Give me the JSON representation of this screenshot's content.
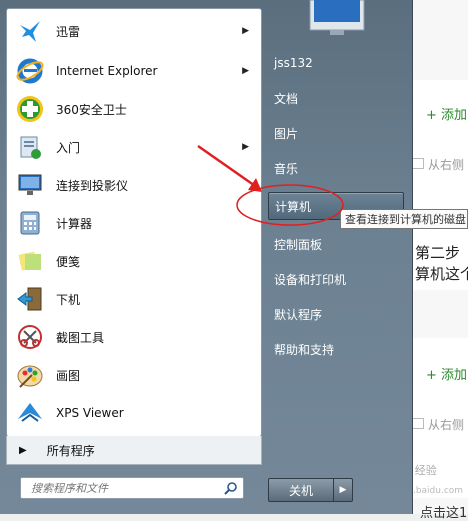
{
  "programs": [
    {
      "label": "迅雷",
      "icon": "xunlei-bird-icon",
      "arrow": true
    },
    {
      "label": "Internet Explorer",
      "icon": "internet-explorer-icon",
      "arrow": true
    },
    {
      "label": "360安全卫士",
      "icon": "360-safeguard-icon",
      "arrow": false
    },
    {
      "label": "入门",
      "icon": "getting-started-icon",
      "arrow": true
    },
    {
      "label": "连接到投影仪",
      "icon": "projector-icon",
      "arrow": false
    },
    {
      "label": "计算器",
      "icon": "calculator-icon",
      "arrow": false
    },
    {
      "label": "便笺",
      "icon": "sticky-notes-icon",
      "arrow": false
    },
    {
      "label": "下机",
      "icon": "exit-door-icon",
      "arrow": false
    },
    {
      "label": "截图工具",
      "icon": "snipping-tool-icon",
      "arrow": false
    },
    {
      "label": "画图",
      "icon": "paint-palette-icon",
      "arrow": false
    },
    {
      "label": "XPS Viewer",
      "icon": "xps-viewer-icon",
      "arrow": false
    }
  ],
  "all_programs_label": "所有程序",
  "search_placeholder": "搜索程序和文件",
  "right_items": [
    {
      "label": "jss132",
      "name": "user-folder"
    },
    {
      "label": "文档",
      "name": "documents"
    },
    {
      "label": "图片",
      "name": "pictures"
    },
    {
      "label": "音乐",
      "name": "music"
    },
    {
      "label": "计算机",
      "name": "computer"
    },
    {
      "label": "控制面板",
      "name": "control-panel"
    },
    {
      "label": "设备和打印机",
      "name": "devices-printers"
    },
    {
      "label": "默认程序",
      "name": "default-programs"
    },
    {
      "label": "帮助和支持",
      "name": "help-support"
    }
  ],
  "shutdown_label": "关机",
  "tooltip": "查看连接到计算机的磁盘",
  "background": {
    "add_label_1": "+ 添加的",
    "hint_1": "从右侧",
    "step_text_1": "第二步",
    "step_text_2": "算机这个",
    "add_label_2": "+ 添加的",
    "hint_2": "从右侧",
    "watermark": "Baidu 经验",
    "watermark_url": "jingyan.baidu.com",
    "bottom_text": "点击这1"
  },
  "colors": {
    "menu_bg": "#6b8090",
    "highlight_border": "#2e3c48",
    "annotation_red": "#e02020",
    "accent_green": "#2a8a2a"
  }
}
